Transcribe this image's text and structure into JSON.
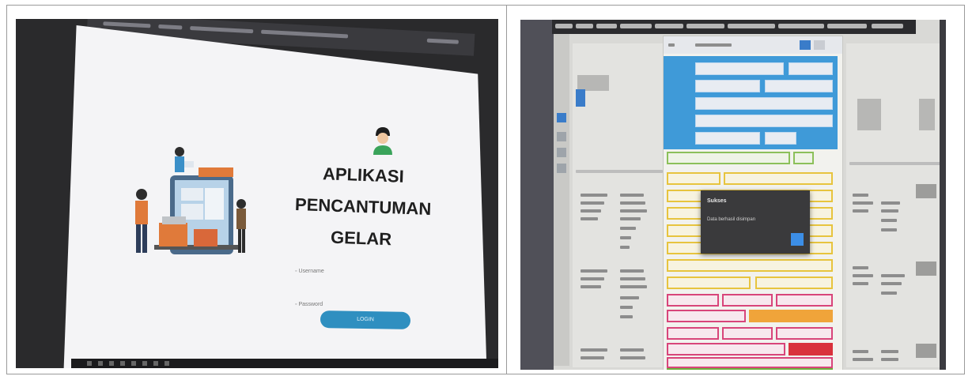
{
  "login_photo": {
    "app_title_lines": [
      "APLIKASI",
      "PENCANTUMAN",
      "GELAR"
    ],
    "username_label": "Username",
    "password_label": "Password",
    "login_button_label": "LOGIN"
  },
  "form_photo": {
    "dialog_title": "Sukses",
    "dialog_message": "Data berhasil disimpan"
  },
  "colors": {
    "login_button": "#2f8fc0",
    "form_header_panel": "#3f9ad8",
    "yellow_group": "#e7c43e",
    "green_group": "#8cc05a",
    "pink_group": "#d8457a",
    "orange_block": "#f0a43a",
    "red_block": "#d9323c",
    "green_bar": "#6aae3c"
  }
}
